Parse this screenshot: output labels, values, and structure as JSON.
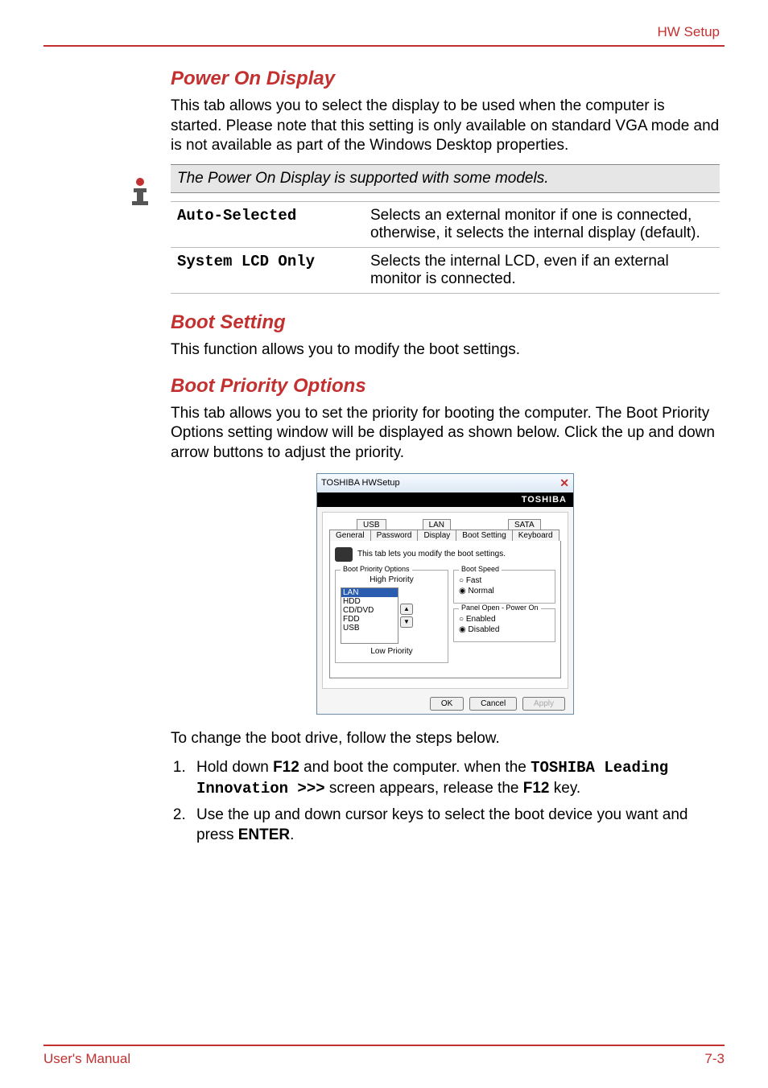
{
  "header": {
    "right": "HW Setup"
  },
  "s1": {
    "title": "Power On Display",
    "body": "This tab allows you to select the display to be used when the computer is started. Please note that this setting is only available on standard VGA mode and is not available as part of the Windows Desktop properties.",
    "note": "The Power On Display is supported with some models.",
    "opts": [
      {
        "label": "Auto-Selected",
        "desc": "Selects an external monitor if one is connected, otherwise, it selects the internal display (default)."
      },
      {
        "label": "System LCD Only",
        "desc": "Selects the internal LCD, even if an external monitor is connected."
      }
    ]
  },
  "s2": {
    "title": "Boot Setting",
    "body": "This function allows you to modify the boot settings."
  },
  "s3": {
    "title": "Boot Priority Options",
    "body": "This tab allows you to set the priority for booting the computer. The Boot Priority Options setting window will be displayed as shown below. Click the up and down arrow buttons to adjust the priority."
  },
  "win": {
    "title": "TOSHIBA HWSetup",
    "brand": "TOSHIBA",
    "tabs1": [
      "USB",
      "LAN",
      "SATA"
    ],
    "tabs2": [
      "General",
      "Password",
      "Display",
      "Boot Setting",
      "Keyboard"
    ],
    "desc": "This tab lets you modify the boot settings.",
    "group_bpo": "Boot Priority Options",
    "hp": "High Priority",
    "list": [
      "LAN",
      "HDD",
      "CD/DVD",
      "FDD",
      "USB"
    ],
    "lp": "Low Priority",
    "group_bs": "Boot Speed",
    "r_fast": "Fast",
    "r_normal": "Normal",
    "group_pop": "Panel Open - Power On",
    "r_enabled": "Enabled",
    "r_disabled": "Disabled",
    "ok": "OK",
    "cancel": "Cancel",
    "apply": "Apply"
  },
  "after_img": "To change the boot drive, follow the steps below.",
  "steps": {
    "s1a": "Hold down ",
    "s1b": "F12",
    "s1c": " and boot the computer. when the ",
    "s1d": "TOSHIBA Leading Innovation >>>",
    "s1e": " screen appears, release the ",
    "s1f": "F12",
    "s1g": " key.",
    "s2a": "Use the up and down cursor keys to select the boot device you want and press ",
    "s2b": "ENTER",
    "s2c": "."
  },
  "footer": {
    "left": "User's Manual",
    "right": "7-3"
  }
}
